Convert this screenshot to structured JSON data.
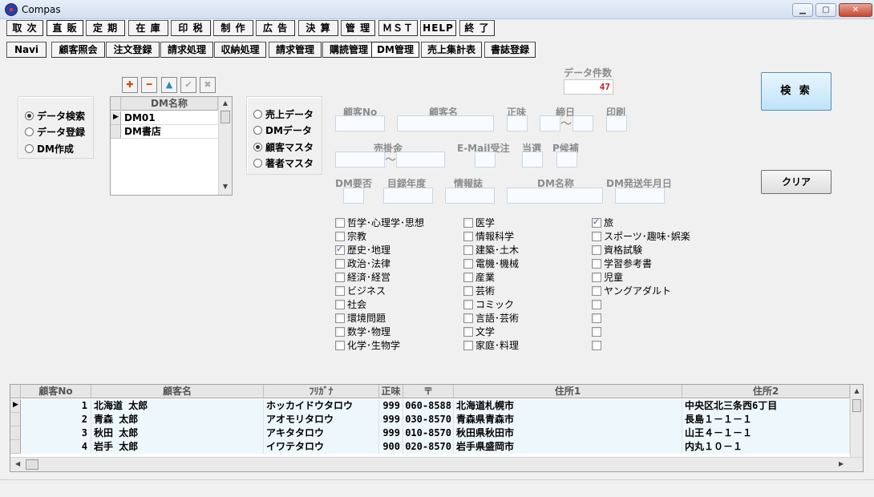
{
  "window": {
    "title": "Compas"
  },
  "menu": [
    "取 次",
    "直 販",
    "定 期",
    "在 庫",
    "印 税",
    "制 作",
    "広 告",
    "決 算",
    "管 理",
    "ＭＳＴ",
    "HELP",
    "終 了"
  ],
  "submenu": [
    "Navi",
    "顧客照会",
    "注文登録",
    "請求処理",
    "収納処理",
    "請求管理",
    "購読管理",
    "DM管理",
    "売上集計表",
    "書誌登録"
  ],
  "mode_radios": [
    {
      "label": "データ検索",
      "checked": true
    },
    {
      "label": "データ登録",
      "checked": false
    },
    {
      "label": "DM作成",
      "checked": false
    }
  ],
  "dm_list": {
    "header": "DM名称",
    "items": [
      "DM01",
      "DM書店"
    ]
  },
  "source_radios": [
    {
      "label": "売上データ",
      "checked": false
    },
    {
      "label": "DMデータ",
      "checked": false
    },
    {
      "label": "顧客マスタ",
      "checked": true
    },
    {
      "label": "著者マスタ",
      "checked": false
    }
  ],
  "count": {
    "label": "データ件数",
    "value": "47"
  },
  "fields": {
    "customer_no": "顧客No",
    "customer_name": "顧客名",
    "seimi": "正味",
    "shimebi": "締日",
    "insatsu": "印刷",
    "urikake": "売掛金",
    "email": "E-Mail受注",
    "tosen": "当選",
    "pkoho": "P候補",
    "dm_yohi": "DM要否",
    "mokuroku": "目録年度",
    "johoshi": "情報誌",
    "dm_name": "DM名称",
    "dm_date": "DM発送年月日",
    "tilde": "〜"
  },
  "buttons": {
    "search": "検 索",
    "clear": "クリア"
  },
  "categories": [
    [
      {
        "label": "哲学･心理学･思想",
        "checked": false
      },
      {
        "label": "宗教",
        "checked": false
      },
      {
        "label": "歴史･地理",
        "checked": true
      },
      {
        "label": "政治･法律",
        "checked": false
      },
      {
        "label": "経済･経営",
        "checked": false
      },
      {
        "label": "ビジネス",
        "checked": false
      },
      {
        "label": "社会",
        "checked": false
      },
      {
        "label": "環境問題",
        "checked": false
      },
      {
        "label": "数学･物理",
        "checked": false
      },
      {
        "label": "化学･生物学",
        "checked": false
      }
    ],
    [
      {
        "label": "医学",
        "checked": false
      },
      {
        "label": "情報科学",
        "checked": false
      },
      {
        "label": "建築･土木",
        "checked": false
      },
      {
        "label": "電機･機械",
        "checked": false
      },
      {
        "label": "産業",
        "checked": false
      },
      {
        "label": "芸術",
        "checked": false
      },
      {
        "label": "コミック",
        "checked": false
      },
      {
        "label": "言語･芸術",
        "checked": false
      },
      {
        "label": "文学",
        "checked": false
      },
      {
        "label": "家庭･料理",
        "checked": false
      }
    ],
    [
      {
        "label": "旅",
        "checked": true
      },
      {
        "label": "スポーツ･趣味･娯楽",
        "checked": false
      },
      {
        "label": "資格試験",
        "checked": false
      },
      {
        "label": "学習参考書",
        "checked": false
      },
      {
        "label": "児童",
        "checked": false
      },
      {
        "label": "ヤングアダルト",
        "checked": false
      },
      {
        "label": "",
        "checked": false
      },
      {
        "label": "",
        "checked": false
      },
      {
        "label": "",
        "checked": false
      },
      {
        "label": "",
        "checked": false
      }
    ]
  ],
  "results": {
    "columns": [
      "顧客No",
      "顧客名",
      "ﾌﾘｶﾞﾅ",
      "正味",
      "〒",
      "住所1",
      "住所2"
    ],
    "rows": [
      [
        "1",
        "北海道 太郎",
        "ホッカイドウタロウ",
        "999",
        "060-8588",
        "北海道札幌市",
        "中央区北三条西6丁目"
      ],
      [
        "2",
        "青森 太郎",
        "アオモリタロウ",
        "999",
        "030-8570",
        "青森県青森市",
        "長島１－１－１"
      ],
      [
        "3",
        "秋田 太郎",
        "アキタタロウ",
        "999",
        "010-8570",
        "秋田県秋田市",
        "山王４－１－１"
      ],
      [
        "4",
        "岩手 太郎",
        "イワテタロウ",
        "900",
        "020-8570",
        "岩手県盛岡市",
        "内丸１０－１"
      ]
    ]
  },
  "colors": {
    "accent_red": "#c81e1e",
    "search_bg": "#bfe3f7",
    "row_bg": "#eef7fc"
  }
}
